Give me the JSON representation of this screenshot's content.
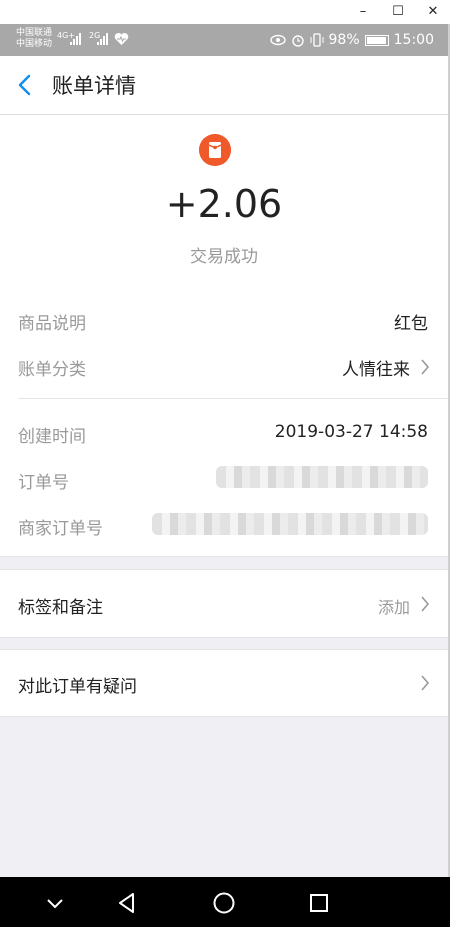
{
  "window": {
    "minimize": "–",
    "maximize": "☐",
    "close": "✕"
  },
  "status_bar": {
    "carrier1": "中国联通",
    "carrier2": "中国移动",
    "net1": "4G+",
    "net2": "2G",
    "battery": "98%",
    "time": "15:00"
  },
  "header": {
    "title": "账单详情"
  },
  "transaction": {
    "icon": "red-packet-icon",
    "amount": "+2.06",
    "status": "交易成功"
  },
  "details": {
    "product_label": "商品说明",
    "product_value": "红包",
    "category_label": "账单分类",
    "category_value": "人情往来",
    "created_label": "创建时间",
    "created_value": "2019-03-27 14:58",
    "order_label": "订单号",
    "merchant_order_label": "商家订单号"
  },
  "tags": {
    "label": "标签和备注",
    "action": "添加"
  },
  "question": {
    "label": "对此订单有疑问"
  },
  "colors": {
    "accent": "#108ee9",
    "red_packet": "#f0592a",
    "background": "#efeff4"
  }
}
